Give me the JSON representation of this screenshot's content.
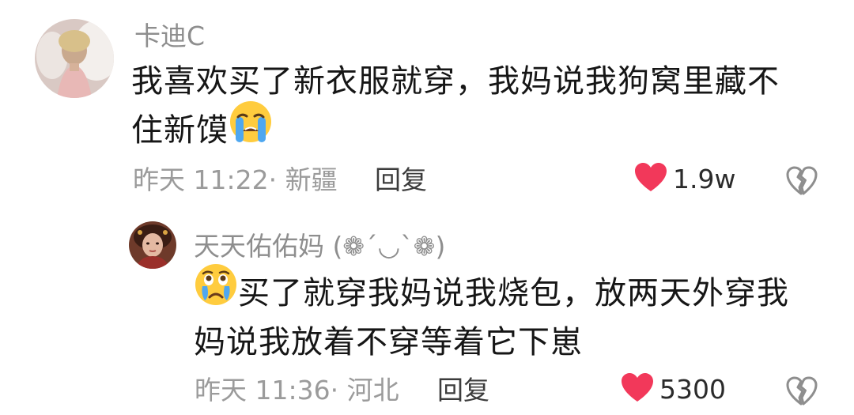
{
  "comment": {
    "username": "卡迪C",
    "text_line1": "我喜欢买了新衣服就穿，我妈说我狗窝里藏不",
    "text_line2": "住新馍",
    "emoji": "loudly-crying-face",
    "time": "昨天 11:22",
    "location": "· 新疆",
    "reply_label": "回复",
    "likes": "1.9w"
  },
  "reply": {
    "username": "天天佑佑妈 (❁´◡`❁)",
    "emoji": "crying-face-with-tears",
    "text_line1": "买了就穿我妈说我烧包，放两天外穿我",
    "text_line2": "妈说我放着不穿等着它下崽",
    "time": "昨天 11:36",
    "location": "· 河北",
    "reply_label": "回复",
    "likes": "5300"
  },
  "colors": {
    "heart": "#f2385a",
    "username": "#8e8e8e",
    "text": "#161616",
    "meta": "#9b9b9b"
  },
  "icons": {
    "like": "heart-icon",
    "dislike": "broken-heart-icon"
  }
}
